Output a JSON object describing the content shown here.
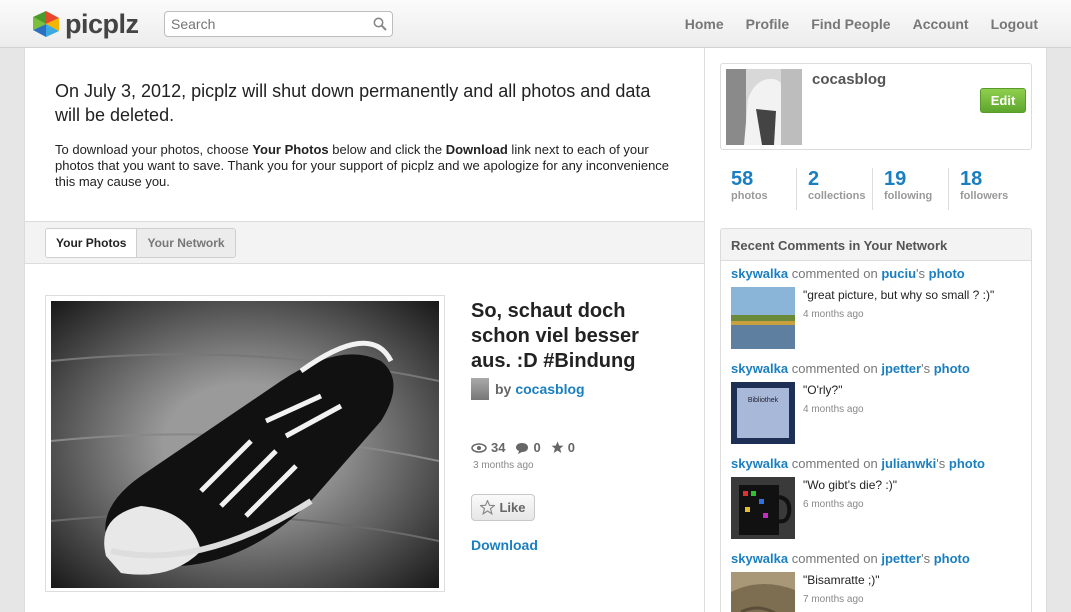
{
  "header": {
    "logo_text": "picplz",
    "search_placeholder": "Search",
    "nav": [
      "Home",
      "Profile",
      "Find People",
      "Account",
      "Logout"
    ]
  },
  "notice": {
    "headline": "On July 3, 2012, picplz will shut down permanently and all photos and data will be deleted.",
    "body_pre": "To download your photos, choose ",
    "body_bold1": "Your Photos",
    "body_mid": " below and click the ",
    "body_bold2": "Download",
    "body_post": " link next to each of your photos that you want to save. Thank you for your support of picplz and we apologize for any inconvenience this may cause you."
  },
  "tabs": [
    "Your Photos",
    "Your Network"
  ],
  "post": {
    "title": "So, schaut doch schon viel besser aus. :D #Bindung",
    "by": "by",
    "author": "cocasblog",
    "views": "34",
    "comments": "0",
    "likes": "0",
    "time": "3 months ago",
    "like_label": "Like",
    "download_label": "Download"
  },
  "profile": {
    "username": "cocasblog",
    "edit_label": "Edit",
    "counts": [
      {
        "n": "58",
        "l": "photos"
      },
      {
        "n": "2",
        "l": "collections"
      },
      {
        "n": "19",
        "l": "following"
      },
      {
        "n": "18",
        "l": "followers"
      }
    ]
  },
  "recent": {
    "heading": "Recent Comments in Your Network",
    "commented_on": "commented on",
    "possessive": "'s",
    "photo_word": "photo",
    "items": [
      {
        "user": "skywalka",
        "owner": "puciu",
        "text": "\"great picture, but why so small ? :)\"",
        "time": "4 months ago"
      },
      {
        "user": "skywalka",
        "owner": "jpetter",
        "text": "\"O'rly?\"",
        "time": "4 months ago"
      },
      {
        "user": "skywalka",
        "owner": "julianwki",
        "text": "\"Wo gibt's die? :)\"",
        "time": "6 months ago"
      },
      {
        "user": "skywalka",
        "owner": "jpetter",
        "text": "\"Bisamratte ;)\"",
        "time": "7 months ago"
      }
    ],
    "thumb2_text": "Bibliothek"
  }
}
